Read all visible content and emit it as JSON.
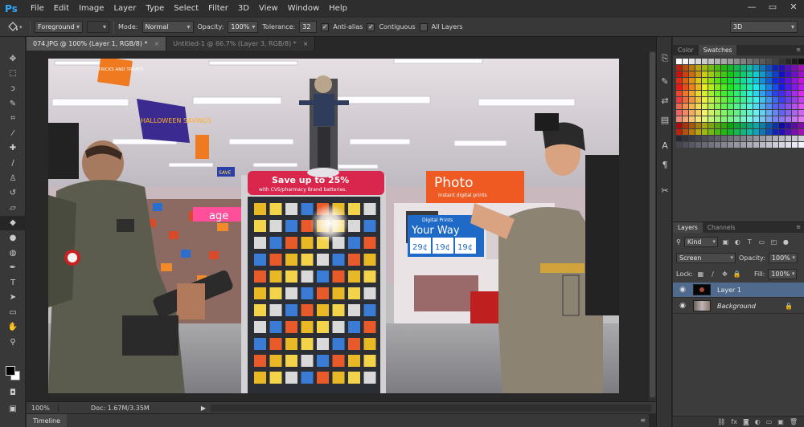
{
  "app": {
    "logo": "Ps"
  },
  "menu": [
    "File",
    "Edit",
    "Image",
    "Layer",
    "Type",
    "Select",
    "Filter",
    "3D",
    "View",
    "Window",
    "Help"
  ],
  "window_controls": [
    "—",
    "▭",
    "✕"
  ],
  "options": {
    "fill_source": "Foreground",
    "mode_label": "Mode:",
    "mode_value": "Normal",
    "opacity_label": "Opacity:",
    "opacity_value": "100%",
    "tolerance_label": "Tolerance:",
    "tolerance_value": "32",
    "anti_alias": "Anti-alias",
    "contiguous": "Contiguous",
    "all_layers": "All Layers",
    "workspace": "3D"
  },
  "tabs": [
    {
      "label": "074.JPG @ 100% (Layer 1, RGB/8) *",
      "close": "×"
    },
    {
      "label": "Untitled-1 @ 66.7% (Layer 3, RGB/8) *",
      "close": "×"
    }
  ],
  "status": {
    "zoom": "100%",
    "doc": "Doc: 1.67M/3.35M"
  },
  "timeline": {
    "label": "Timeline"
  },
  "swatches_panel": {
    "tabs": [
      "Color",
      "Swatches"
    ]
  },
  "layers_panel": {
    "tabs": [
      "Layers",
      "Channels"
    ],
    "kind_label": "Kind",
    "blend_mode": "Screen",
    "opacity_label": "Opacity:",
    "opacity_value": "100%",
    "lock_label": "Lock:",
    "fill_label": "Fill:",
    "fill_value": "100%",
    "layers": [
      {
        "name": "Layer 1",
        "selected": true
      },
      {
        "name": "Background",
        "selected": false
      }
    ]
  },
  "photo": {
    "signs": {
      "treats": "TRICKS AND TREATS",
      "halloween": "HALLOWEEN SAVINGS",
      "save": "Save up to 25%",
      "save_sub": "with CVS/pharmacy Brand batteries.",
      "photo": "Photo",
      "photo_sub": "Instant digital prints",
      "your_way": "Your Way",
      "digital_prints": "Digital Prints",
      "prices": [
        "29¢",
        "19¢",
        "19¢"
      ],
      "savings_small": "SAVE",
      "age": "age"
    }
  },
  "icons": {
    "tools": [
      "move-tool-icon",
      "marquee-tool-icon",
      "lasso-tool-icon",
      "quick-select-tool-icon",
      "crop-tool-icon",
      "eyedropper-tool-icon",
      "healing-brush-icon",
      "brush-tool-icon",
      "clone-stamp-icon",
      "history-brush-icon",
      "eraser-tool-icon",
      "paint-bucket-icon",
      "blur-tool-icon",
      "dodge-tool-icon",
      "pen-tool-icon",
      "type-tool-icon",
      "path-select-icon",
      "shape-tool-icon",
      "hand-tool-icon",
      "zoom-tool-icon"
    ]
  }
}
